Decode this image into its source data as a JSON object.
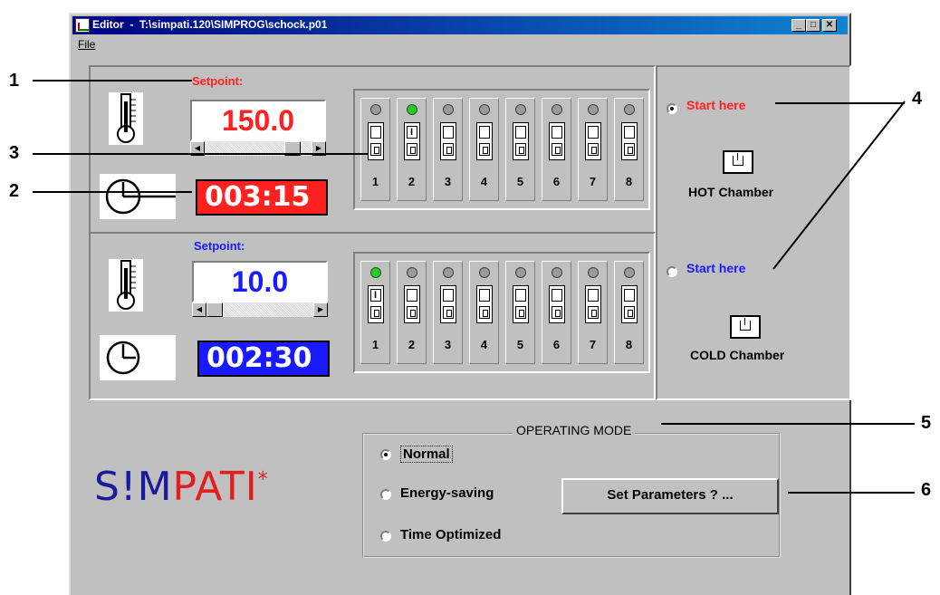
{
  "window": {
    "title": "Editor  -  T:\\simpati.120\\SIMPROG\\schock.p01",
    "menu": [
      "File"
    ],
    "controls": {
      "minimize": "_",
      "maximize": "□",
      "close": "✕"
    }
  },
  "hot": {
    "setpoint_label": "Setpoint:",
    "setpoint_value": "150.0",
    "slider_level": 0.85,
    "timer": "003:15",
    "switches": [
      {
        "n": "1",
        "on": false
      },
      {
        "n": "2",
        "on": true
      },
      {
        "n": "3",
        "on": false
      },
      {
        "n": "4",
        "on": false
      },
      {
        "n": "5",
        "on": false
      },
      {
        "n": "6",
        "on": false
      },
      {
        "n": "7",
        "on": false
      },
      {
        "n": "8",
        "on": false
      }
    ],
    "start_label": "Start here",
    "start_selected": true,
    "chamber_label": "HOT Chamber",
    "color": "#ff2020"
  },
  "cold": {
    "setpoint_label": "Setpoint:",
    "setpoint_value": "10.0",
    "slider_level": 0.1,
    "timer": "002:30",
    "switches": [
      {
        "n": "1",
        "on": true
      },
      {
        "n": "2",
        "on": false
      },
      {
        "n": "3",
        "on": false
      },
      {
        "n": "4",
        "on": false
      },
      {
        "n": "5",
        "on": false
      },
      {
        "n": "6",
        "on": false
      },
      {
        "n": "7",
        "on": false
      },
      {
        "n": "8",
        "on": false
      }
    ],
    "start_label": "Start here",
    "start_selected": false,
    "chamber_label": "COLD Chamber",
    "color": "#1a1aff"
  },
  "operating_mode": {
    "title": "OPERATING MODE",
    "options": [
      "Normal",
      "Energy-saving",
      "Time Optimized"
    ],
    "selected": 0,
    "button": "Set Parameters ? ..."
  },
  "logo": {
    "text_s": "S!M",
    "text_p": "PATI",
    "star": "*"
  },
  "callouts": [
    "1",
    "2",
    "3",
    "4",
    "5",
    "6"
  ]
}
